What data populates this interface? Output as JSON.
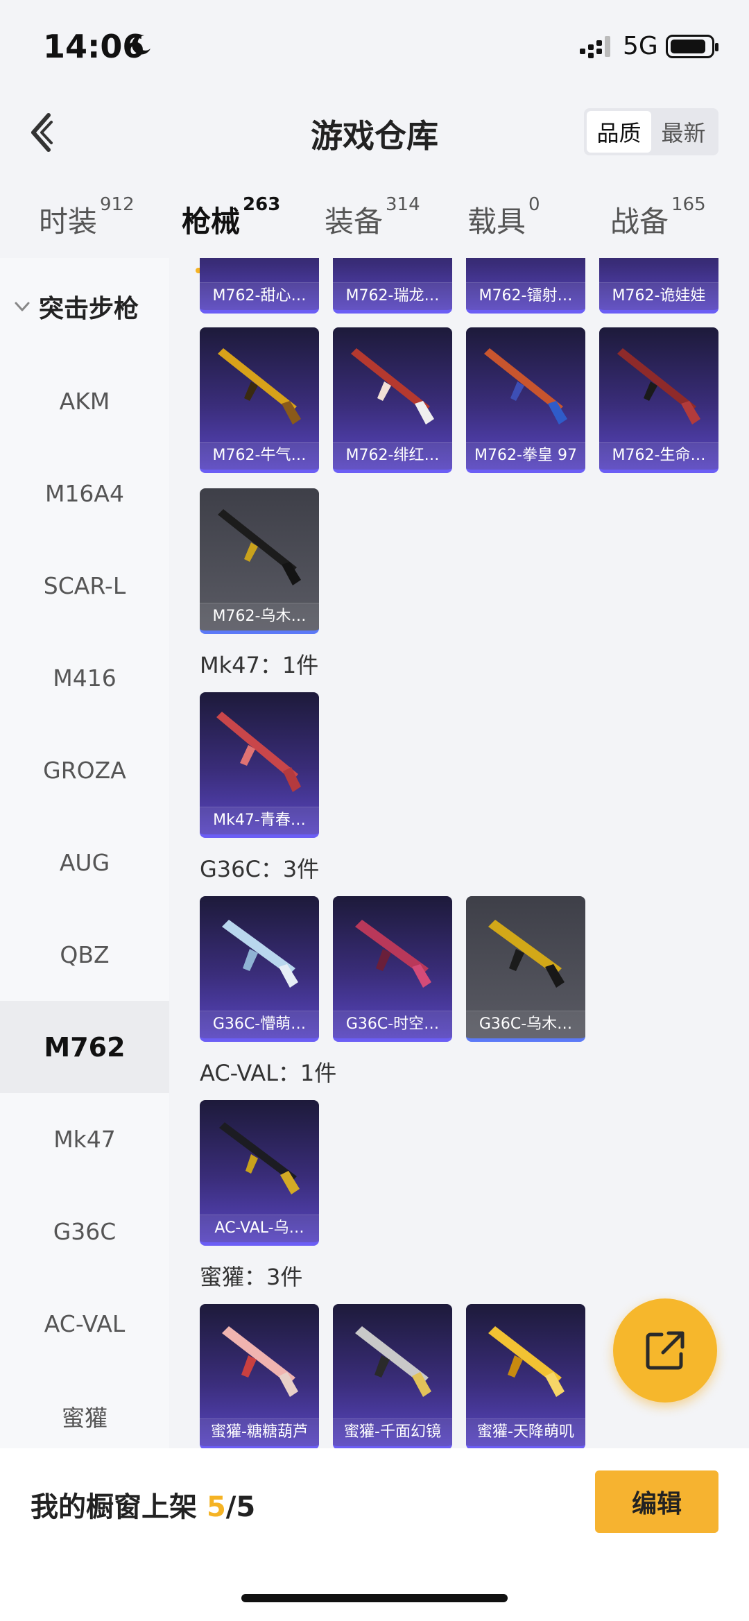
{
  "status": {
    "time": "14:06",
    "network": "5G"
  },
  "header": {
    "title": "游戏仓库",
    "sort_options": [
      "品质",
      "最新"
    ]
  },
  "tabs": [
    {
      "label": "时装",
      "count": "912"
    },
    {
      "label": "枪械",
      "count": "263"
    },
    {
      "label": "装备",
      "count": "314"
    },
    {
      "label": "载具",
      "count": "0"
    },
    {
      "label": "战备",
      "count": "165"
    }
  ],
  "sidebar": {
    "group": "突击步枪",
    "items": [
      "AKM",
      "M16A4",
      "SCAR-L",
      "M416",
      "GROZA",
      "AUG",
      "QBZ",
      "M762",
      "Mk47",
      "G36C",
      "AC-VAL",
      "蜜獾"
    ]
  },
  "content": {
    "row0": [
      "M762-甜心…",
      "M762-瑞龙…",
      "M762-镭射…",
      "M762-诡娃娃"
    ],
    "row1": [
      "M762-牛气…",
      "M762-绯红…",
      "M762-拳皇 97",
      "M762-生命…"
    ],
    "row2": [
      "M762-乌木…"
    ],
    "sec_mk47": "Mk47：1件",
    "mk47": [
      "Mk47-青春…"
    ],
    "sec_g36c": "G36C：3件",
    "g36c": [
      "G36C-懵萌…",
      "G36C-时空…",
      "G36C-乌木…"
    ],
    "sec_acval": "AC-VAL：1件",
    "acval": [
      "AC-VAL-乌…"
    ],
    "sec_honey": "蜜獾：3件",
    "honey": [
      "蜜獾-糖糖葫芦",
      "蜜獾-千面幻镜",
      "蜜獾-天降萌叽"
    ]
  },
  "bottom": {
    "label": "我的橱窗上架",
    "used": "5",
    "total": "/5",
    "edit_label": "编辑"
  },
  "colors": {
    "accent": "#f5b324",
    "card_purple": "#5846c0",
    "card_grey": "#5a5b64"
  }
}
